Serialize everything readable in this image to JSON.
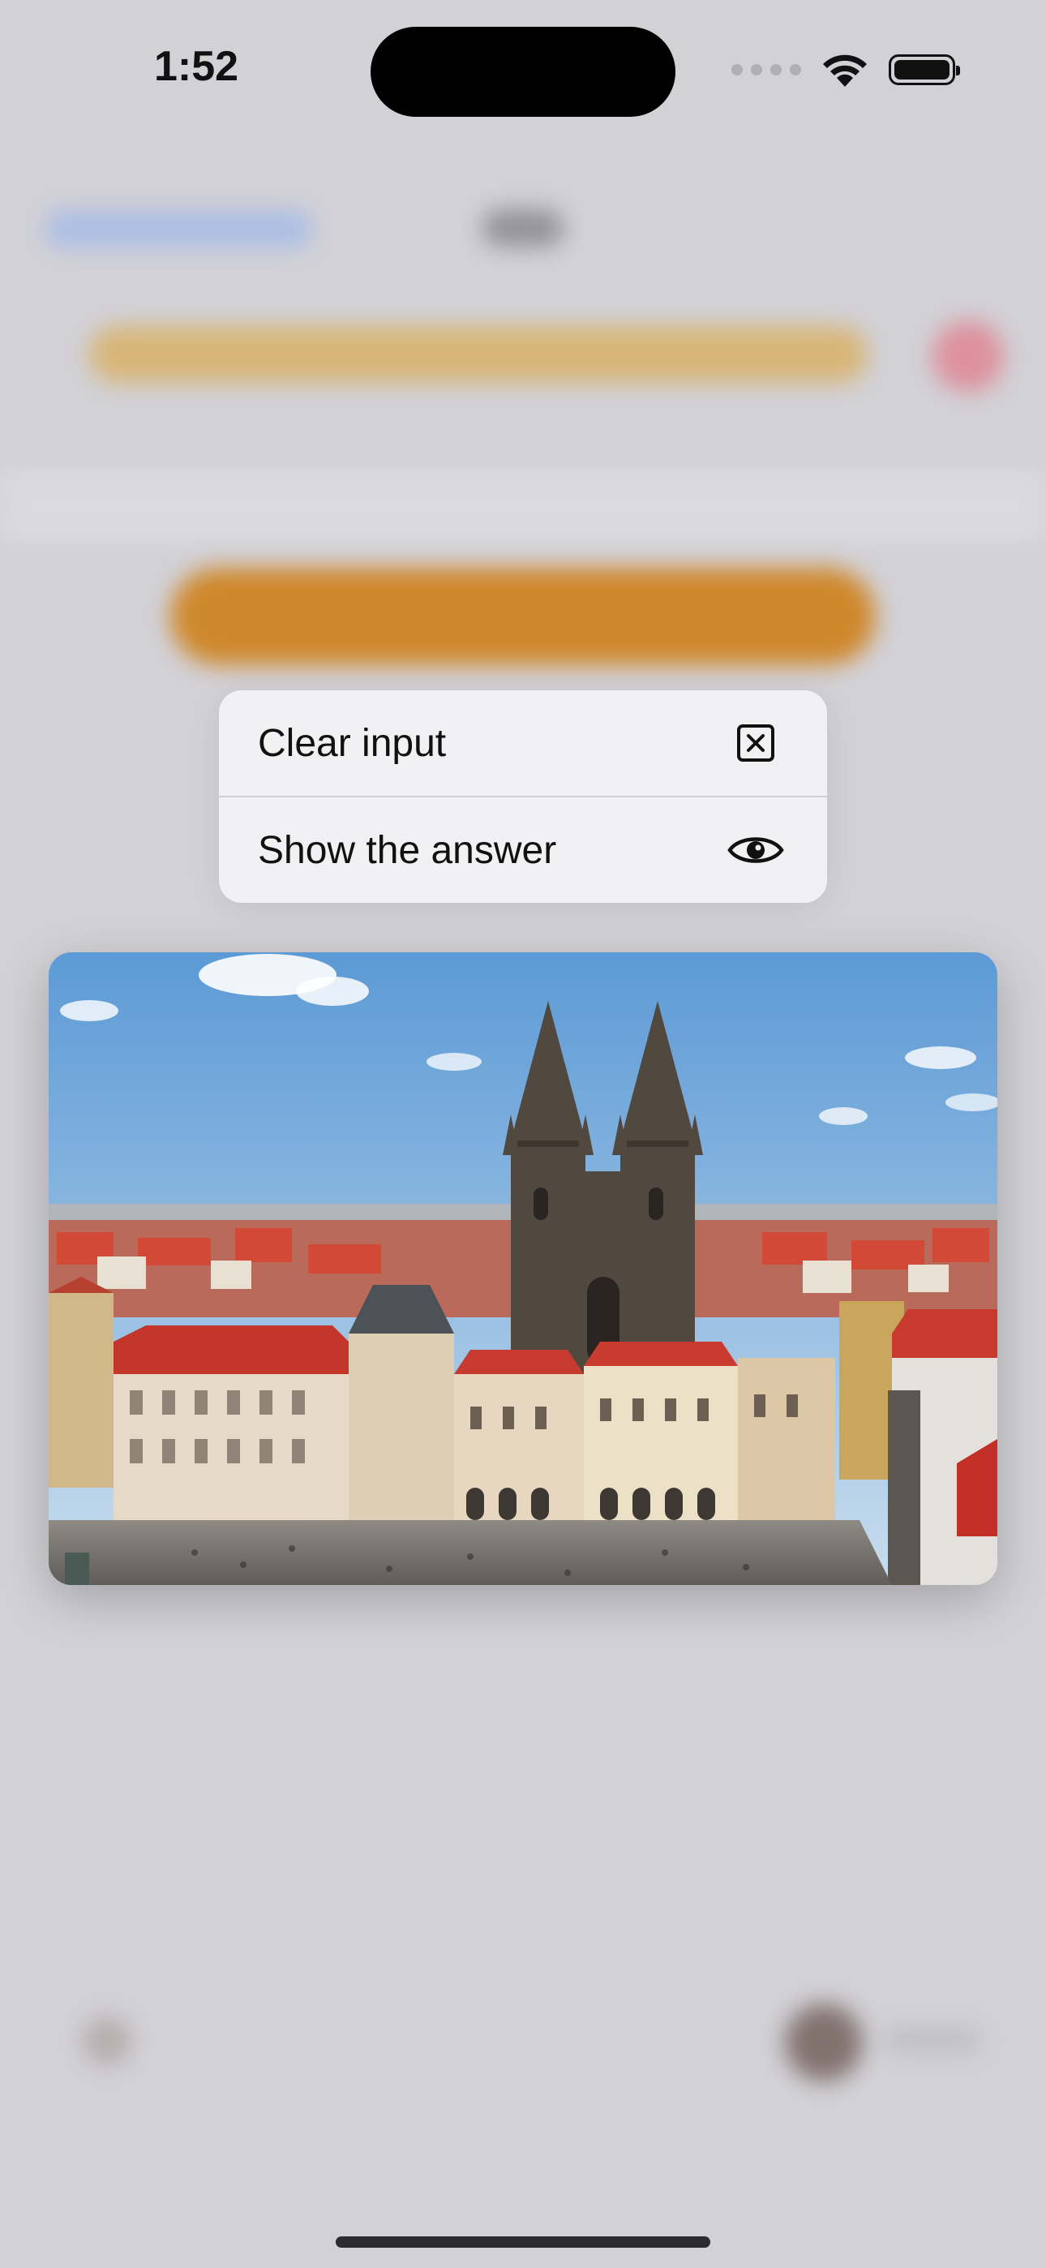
{
  "status_bar": {
    "time": "1:52",
    "icons": [
      "cellular-dots-icon",
      "wifi-icon",
      "battery-icon"
    ]
  },
  "context_menu": {
    "items": [
      {
        "label": "Clear input",
        "icon": "clear-box-icon"
      },
      {
        "label": "Show the answer",
        "icon": "eye-icon"
      }
    ]
  },
  "photo": {
    "subject": "photo-old-town-church-towers",
    "colors": {
      "sky": "#6aa6dd",
      "roofs": "#c9382d",
      "stone": "#5c534b"
    }
  },
  "colors": {
    "background": "#d2d1d6",
    "menu_background": "#f1f1f3",
    "accent_orange": "#cf8019"
  }
}
